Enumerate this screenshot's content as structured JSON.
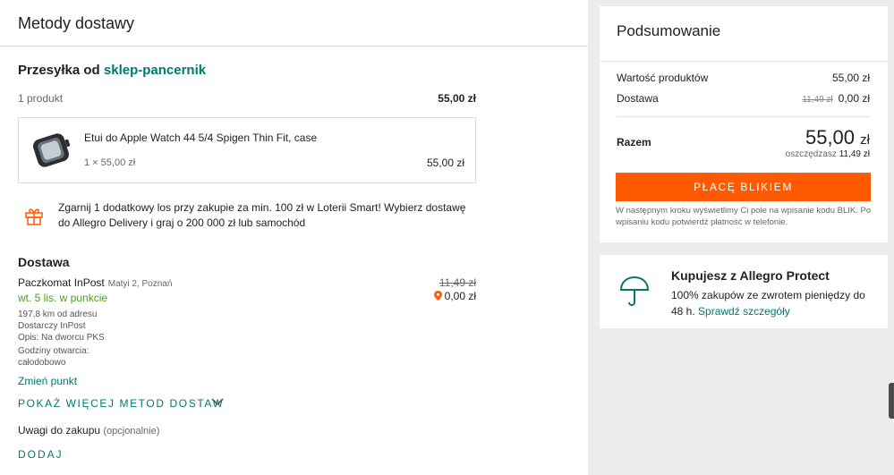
{
  "header": {
    "title": "Metody dostawy"
  },
  "shipment": {
    "prefix": "Przesyłka od",
    "seller": "sklep-pancernik",
    "product_count": "1 produkt",
    "subtotal": "55,00 zł"
  },
  "product": {
    "name": "Etui do Apple Watch 44 5/4 Spigen Thin Fit, case",
    "qty_price": "1 × 55,00 zł",
    "price": "55,00 zł"
  },
  "promo": {
    "icon": "gift-icon",
    "text": "Zgarnij 1 dodatkowy los przy zakupie za min. 100 zł w Loterii Smart! Wybierz dostawę do Allegro Delivery i graj o 200 000 zł lub samochód"
  },
  "delivery": {
    "heading": "Dostawa",
    "method": "Paczkomat InPost",
    "address": "Matyi 2, Poznań",
    "eta": "wt. 5 lis. w punkcie",
    "old_price": "11,49 zł",
    "new_price": "0,00 zł",
    "distance": "197,8 km od adresu",
    "provider": "Dostarczy InPost",
    "description": "Opis: Na dworcu PKS",
    "hours_label": "Godziny otwarcia:",
    "hours_value": "całodobowo",
    "change_link": "Zmień punkt",
    "more_methods": "POKAŻ WIĘCEJ METOD DOSTAW"
  },
  "notes": {
    "label": "Uwagi do zakupu",
    "optional": "(opcjonalnie)",
    "add_button": "DODAJ"
  },
  "summary": {
    "title": "Podsumowanie",
    "products_label": "Wartość produktów",
    "products_value": "55,00 zł",
    "delivery_label": "Dostawa",
    "delivery_old": "11,49 zł",
    "delivery_value": "0,00 zł",
    "total_label": "Razem",
    "total_main": "55,00",
    "total_currency": "zł",
    "savings_label": "oszczędzasz",
    "savings_value": "11,49 zł",
    "pay_button": "PŁACĘ BLIKIEM",
    "pay_note": "W następnym kroku wyświetlimy Ci pole na wpisanie kodu BLIK. Po wpisaniu kodu potwierdź płatność w telefonie."
  },
  "protect": {
    "title": "Kupujesz z Allegro Protect",
    "text": "100% zakupów ze zwrotem pieniędzy do 48 h.",
    "link": "Sprawdź szczegóły"
  },
  "colors": {
    "accent": "#00796b",
    "pay_button": "#ff5a00",
    "eta_green": "#4aa01f",
    "promo_orange": "#ff5a00"
  }
}
